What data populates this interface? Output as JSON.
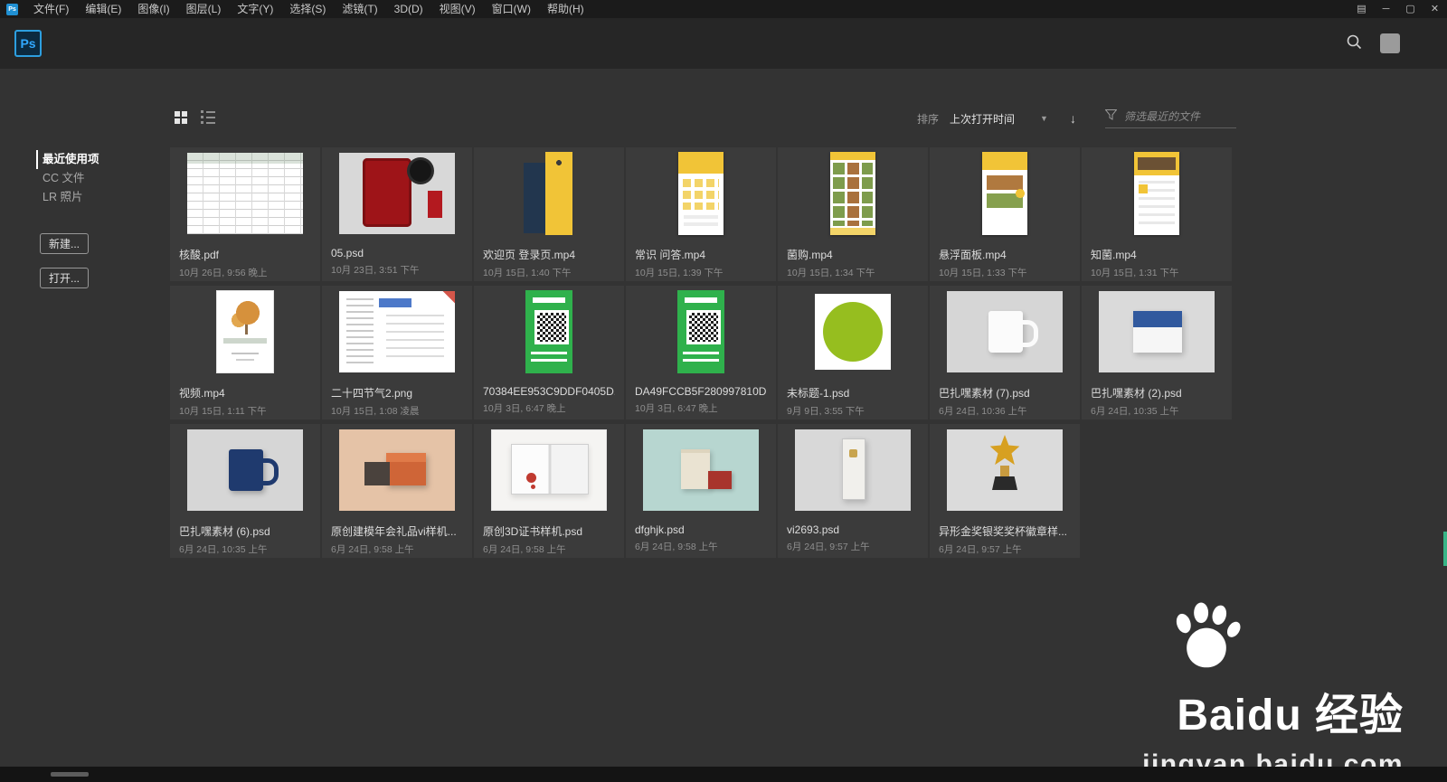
{
  "titlebar": {
    "app_initials": "Ps",
    "menus": [
      "文件(F)",
      "编辑(E)",
      "图像(I)",
      "图层(L)",
      "文字(Y)",
      "选择(S)",
      "滤镜(T)",
      "3D(D)",
      "视图(V)",
      "窗口(W)",
      "帮助(H)"
    ],
    "window_controls": {
      "minimize": "─",
      "maximize": "▢",
      "close": "✕"
    }
  },
  "header": {
    "logo_text": "Ps"
  },
  "sidebar": {
    "items": [
      {
        "label": "最近使用项",
        "active": true
      },
      {
        "label": "CC 文件",
        "active": false
      },
      {
        "label": "LR 照片",
        "active": false
      }
    ],
    "new_button": "新建...",
    "open_button": "打开..."
  },
  "toolbar": {
    "sort_label": "排序",
    "sort_value": "上次打开时间",
    "filter_placeholder": "筛选最近的文件"
  },
  "files": [
    {
      "name": "核酸.pdf",
      "date": "10月 26日, 9:56 晚上",
      "thumb": "doc"
    },
    {
      "name": "05.psd",
      "date": "10月 23日, 3:51 下午",
      "thumb": "tablet"
    },
    {
      "name": "欢迎页 登录页.mp4",
      "date": "10月 15日, 1:40 下午",
      "thumb": "welcome"
    },
    {
      "name": "常识 问答.mp4",
      "date": "10月 15日, 1:39 下午",
      "thumb": "quiz"
    },
    {
      "name": "菌购.mp4",
      "date": "10月 15日, 1:34 下午",
      "thumb": "food"
    },
    {
      "name": "悬浮面板.mp4",
      "date": "10月 15日, 1:33 下午",
      "thumb": "float"
    },
    {
      "name": "知菌.mp4",
      "date": "10月 15日, 1:31 下午",
      "thumb": "zhijun"
    },
    {
      "name": "视频.mp4",
      "date": "10月 15日, 1:11 下午",
      "thumb": "tree"
    },
    {
      "name": "二十四节气2.png",
      "date": "10月 15日, 1:08 凌晨",
      "thumb": "mindmap"
    },
    {
      "name": "70384EE953C9DDF0405D...",
      "date": "10月 3日, 6:47 晚上",
      "thumb": "qr"
    },
    {
      "name": "DA49FCCB5F280997810D...",
      "date": "10月 3日, 6:47 晚上",
      "thumb": "qr"
    },
    {
      "name": "未标题-1.psd",
      "date": "9月 9日, 3:55 下午",
      "thumb": "circle"
    },
    {
      "name": "巴扎嘿素材 (7).psd",
      "date": "6月 24日, 10:36 上午",
      "thumb": "mugwhite"
    },
    {
      "name": "巴扎嘿素材 (2).psd",
      "date": "6月 24日, 10:35 上午",
      "thumb": "boxblue"
    },
    {
      "name": "巴扎嘿素材 (6).psd",
      "date": "6月 24日, 10:35 上午",
      "thumb": "mugblue"
    },
    {
      "name": "原创建模年会礼品vi样机...",
      "date": "6月 24日, 9:58 上午",
      "thumb": "gift"
    },
    {
      "name": "原创3D证书样机.psd",
      "date": "6月 24日, 9:58 上午",
      "thumb": "cert"
    },
    {
      "name": "dfghjk.psd",
      "date": "6月 24日, 9:58 上午",
      "thumb": "bag"
    },
    {
      "name": "vi2693.psd",
      "date": "6月 24日, 9:57 上午",
      "thumb": "plaque"
    },
    {
      "name": "异形金奖银奖奖杯徽章样...",
      "date": "6月 24日, 9:57 上午",
      "thumb": "trophy"
    }
  ],
  "watermark": {
    "brand": "Baidu 经验",
    "url": "jingyan.baidu.com"
  }
}
